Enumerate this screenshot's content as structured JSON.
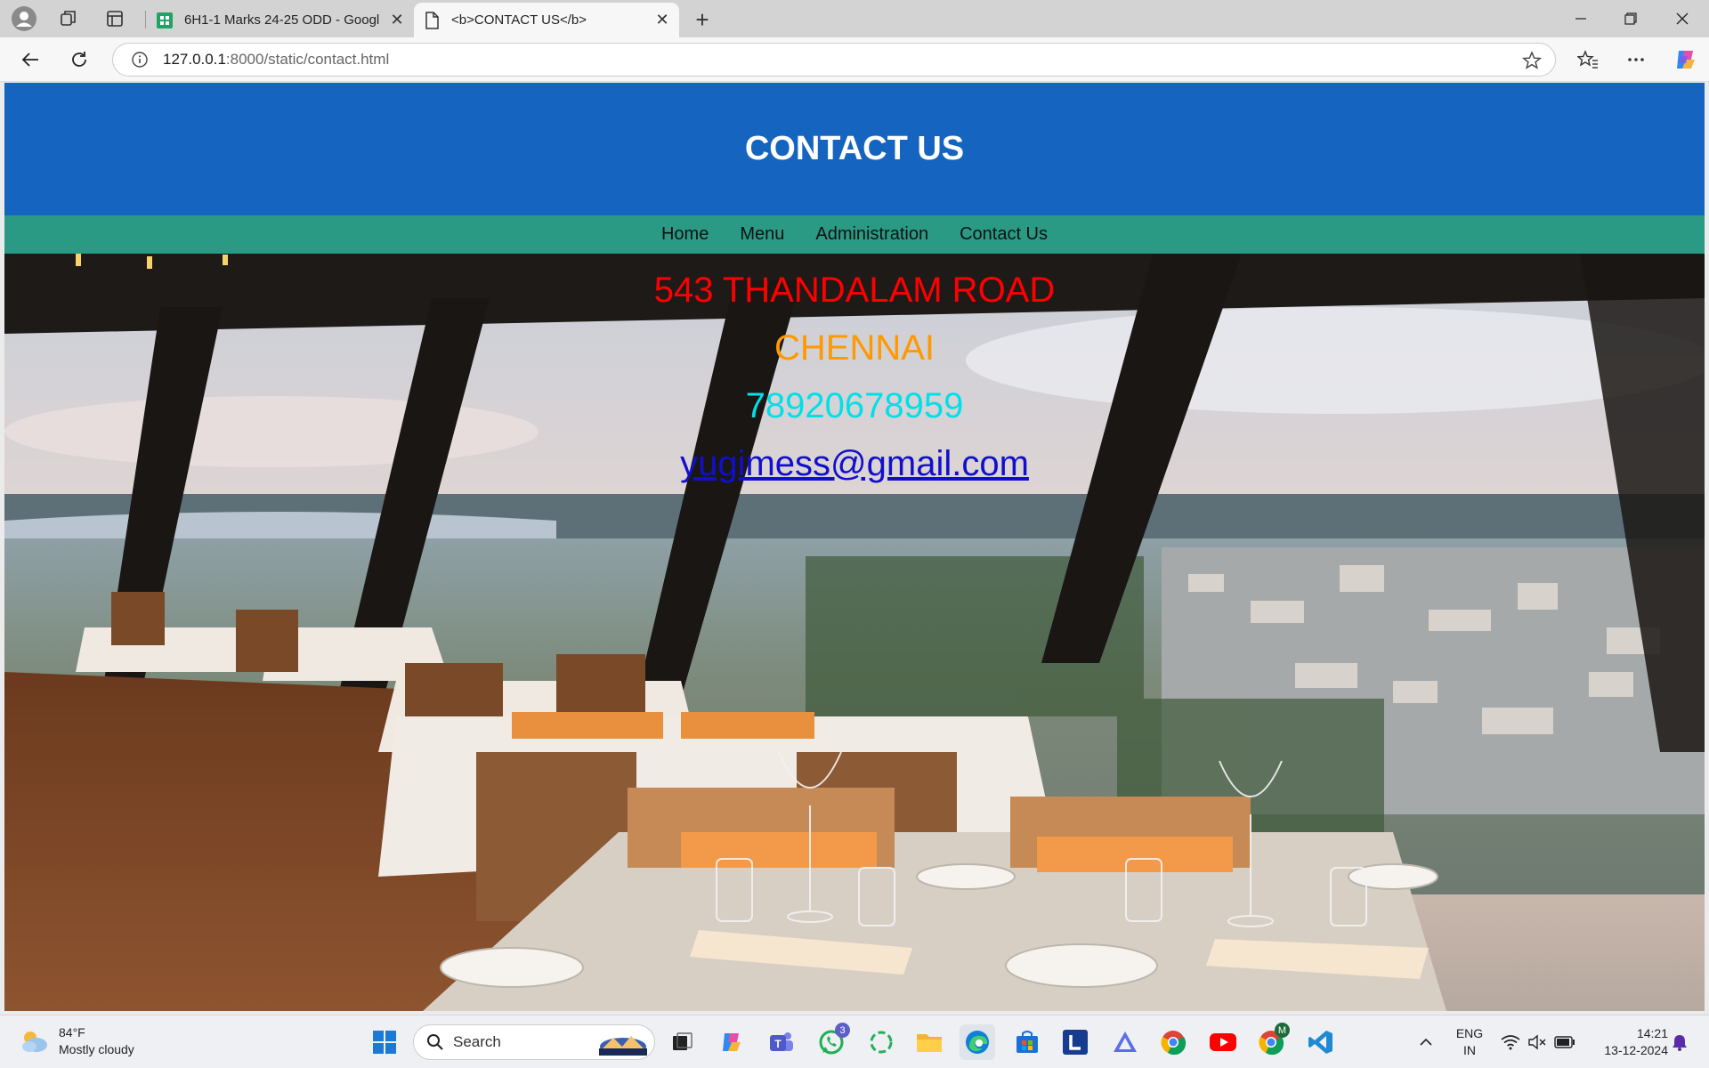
{
  "browser": {
    "tabs": [
      {
        "title": "6H1-1 Marks 24-25 ODD - Googl",
        "active": false,
        "favicon": "google-sheets-icon"
      },
      {
        "title": "<b>CONTACT US</b>",
        "active": true,
        "favicon": "page-icon"
      }
    ],
    "address": {
      "host": "127.0.0.1",
      "path": ":8000/static/contact.html"
    }
  },
  "page": {
    "header_title": "CONTACT US",
    "nav": [
      "Home",
      "Menu",
      "Administration",
      "Contact Us"
    ],
    "contact": {
      "address": "543 THANDALAM ROAD",
      "city": "CHENNAI",
      "phone": "78920678959",
      "email": "yugimess@gmail.com"
    }
  },
  "taskbar": {
    "weather": {
      "temp": "84°F",
      "condition": "Mostly cloudy"
    },
    "search_label": "Search",
    "whatsapp_badge": "3",
    "chrome_badge": "M",
    "tray": {
      "lang_top": "ENG",
      "lang_bottom": "IN",
      "time": "14:21",
      "date": "13-12-2024"
    }
  },
  "colors": {
    "header": "#1565c0",
    "nav": "#2a9a84",
    "address": "#ff0000",
    "city": "#ff9900",
    "phone": "#00e0e8",
    "email": "#1010cc"
  }
}
